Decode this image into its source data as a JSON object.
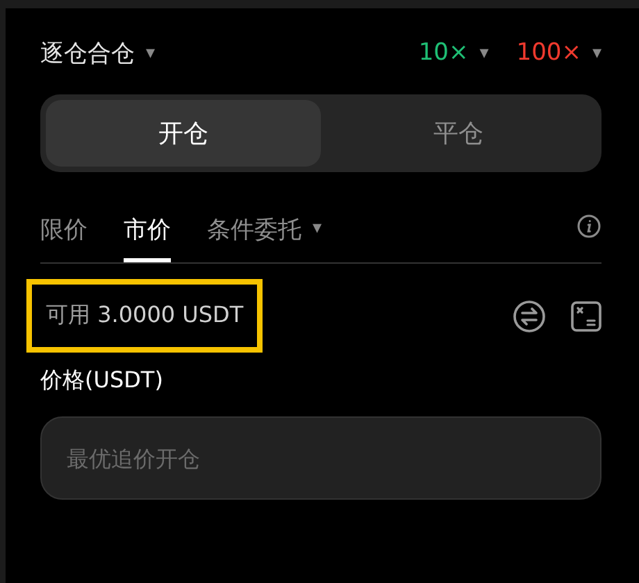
{
  "margin_mode": {
    "label": "逐仓合仓",
    "caret": "▾"
  },
  "leverage": [
    {
      "value": "10×",
      "color": "#1fbf75",
      "caret": "▾"
    },
    {
      "value": "100×",
      "color": "#f03a2e",
      "caret": "▾"
    }
  ],
  "mode_tabs": [
    {
      "label": "开仓",
      "selected": true
    },
    {
      "label": "平仓",
      "selected": false
    }
  ],
  "order_tabs": [
    {
      "label": "限价",
      "selected": false
    },
    {
      "label": "市价",
      "selected": true
    },
    {
      "label": "条件委托",
      "selected": false,
      "caret": "▾"
    }
  ],
  "balance": {
    "label": "可用",
    "value": "3.0000 USDT",
    "highlighted": true
  },
  "price": {
    "label": "价格(USDT)",
    "placeholder": "最优追价开仓"
  }
}
